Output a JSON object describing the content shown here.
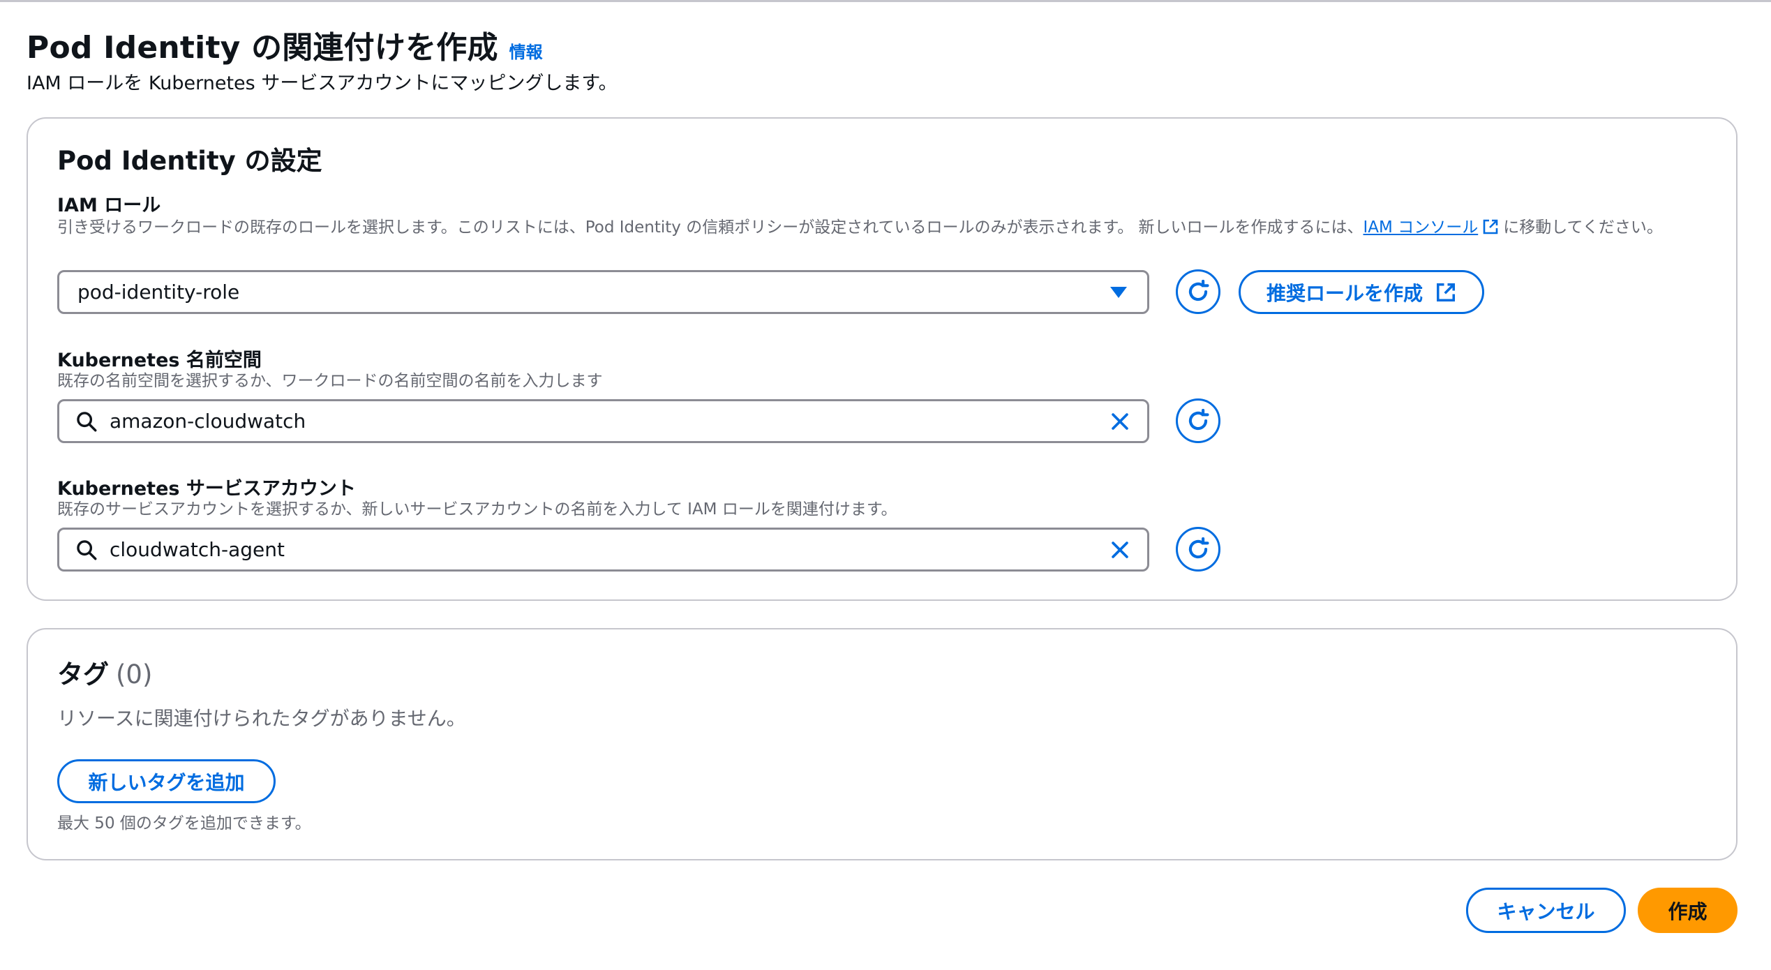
{
  "header": {
    "title": "Pod Identity の関連付けを作成",
    "info_link": "情報",
    "description": "IAM ロールを Kubernetes サービスアカウントにマッピングします。"
  },
  "settings": {
    "title": "Pod Identity の設定",
    "iam_role": {
      "label": "IAM ロール",
      "description_before": "引き受けるワークロードの既存のロールを選択します。このリストには、Pod Identity の信頼ポリシーが設定されているロールのみが表示されます。 新しいロールを作成するには、",
      "console_link": "IAM コンソール",
      "description_after": "に移動してください。",
      "selected_value": "pod-identity-role",
      "create_button": "推奨ロールを作成"
    },
    "namespace": {
      "label": "Kubernetes 名前空間",
      "description": "既存の名前空間を選択するか、ワークロードの名前空間の名前を入力します",
      "value": "amazon-cloudwatch"
    },
    "service_account": {
      "label": "Kubernetes サービスアカウント",
      "description": "既存のサービスアカウントを選択するか、新しいサービスアカウントの名前を入力して IAM ロールを関連付けます。",
      "value": "cloudwatch-agent"
    }
  },
  "tags": {
    "title": "タグ",
    "count": "(0)",
    "empty_message": "リソースに関連付けられたタグがありません。",
    "add_button": "新しいタグを追加",
    "limit_text": "最大 50 個のタグを追加できます。"
  },
  "footer": {
    "cancel": "キャンセル",
    "create": "作成"
  },
  "colors": {
    "accent": "#006ce0",
    "primary_button": "#ff9900",
    "border": "#c6c6cd",
    "muted_text": "#656871"
  }
}
